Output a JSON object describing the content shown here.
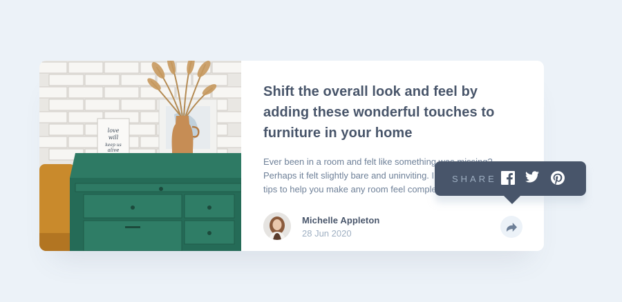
{
  "article": {
    "title": "Shift the overall look and feel by adding these wonderful touches to furniture in your home",
    "description": "Ever been in a room and felt like something was missing? Perhaps it felt slightly bare and uninviting. I’ve got some simple tips to help you make any room feel complete.",
    "hero_image": "drawers-with-plant-image"
  },
  "author": {
    "name": "Michelle Appleton",
    "date": "28 Jun 2020",
    "avatar": "avatar-michelle"
  },
  "share": {
    "label": "SHARE",
    "icons": [
      "facebook-icon",
      "twitter-icon",
      "pinterest-icon"
    ],
    "button_icon": "share-icon"
  },
  "colors": {
    "background": "#ecf2f8",
    "card": "#ffffff",
    "title": "#48556a",
    "text": "#6e8098",
    "muted": "#9eafc2",
    "tooltip": "#48556a"
  }
}
